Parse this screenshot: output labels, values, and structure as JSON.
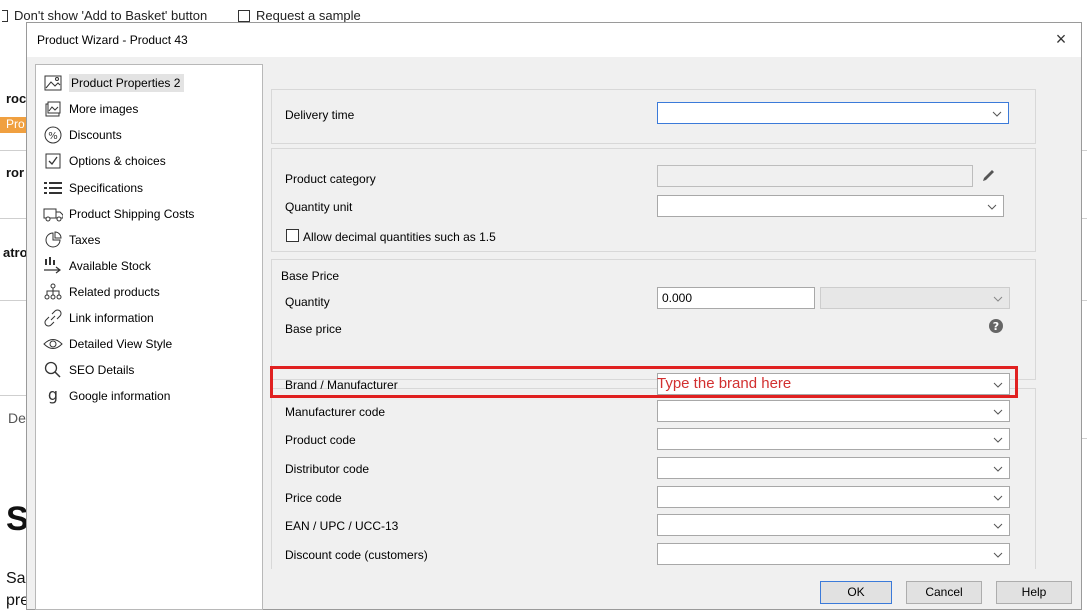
{
  "background": {
    "top_checks": [
      "Don't show 'Add to Basket' button",
      "Request a sample"
    ],
    "fragments": [
      "roc",
      "Pro",
      "ror",
      "atro",
      "De",
      "S",
      "Sa",
      "pre"
    ]
  },
  "dialog": {
    "title": "Product Wizard - Product 43",
    "close_label": "×",
    "nav": [
      {
        "label": "Product Properties 2",
        "icon": "landscape-icon",
        "selected": true
      },
      {
        "label": "More images",
        "icon": "images-icon"
      },
      {
        "label": "Discounts",
        "icon": "percent-icon"
      },
      {
        "label": "Options & choices",
        "icon": "checkbox-icon"
      },
      {
        "label": "Specifications",
        "icon": "list-icon"
      },
      {
        "label": "Product Shipping Costs",
        "icon": "truck-icon"
      },
      {
        "label": "Taxes",
        "icon": "pie-chart-icon"
      },
      {
        "label": "Available Stock",
        "icon": "stock-icon"
      },
      {
        "label": "Related products",
        "icon": "hierarchy-icon"
      },
      {
        "label": "Link information",
        "icon": "link-icon"
      },
      {
        "label": "Detailed View Style",
        "icon": "eye-icon"
      },
      {
        "label": "SEO Details",
        "icon": "search-icon"
      },
      {
        "label": "Google information",
        "icon": "google-icon"
      }
    ],
    "form": {
      "delivery_time_label": "Delivery time",
      "product_category_label": "Product category",
      "quantity_unit_label": "Quantity unit",
      "allow_decimal_label": "Allow decimal quantities such as 1.5",
      "base_price_group": "Base Price",
      "quantity_label": "Quantity",
      "quantity_value": "0.000",
      "base_price_label": "Base price",
      "brand_label": "Brand / Manufacturer",
      "brand_hint": "Type the brand here",
      "manufacturer_code_label": "Manufacturer code",
      "product_code_label": "Product code",
      "distributor_code_label": "Distributor code",
      "price_code_label": "Price code",
      "ean_label": "EAN / UPC / UCC-13",
      "discount_code_label": "Discount code (customers)"
    },
    "buttons": {
      "ok": "OK",
      "cancel": "Cancel",
      "help": "Help"
    },
    "colors": {
      "highlight": "#e02020",
      "hint_text": "#d23030",
      "focus_border": "#3b7ad9"
    }
  }
}
